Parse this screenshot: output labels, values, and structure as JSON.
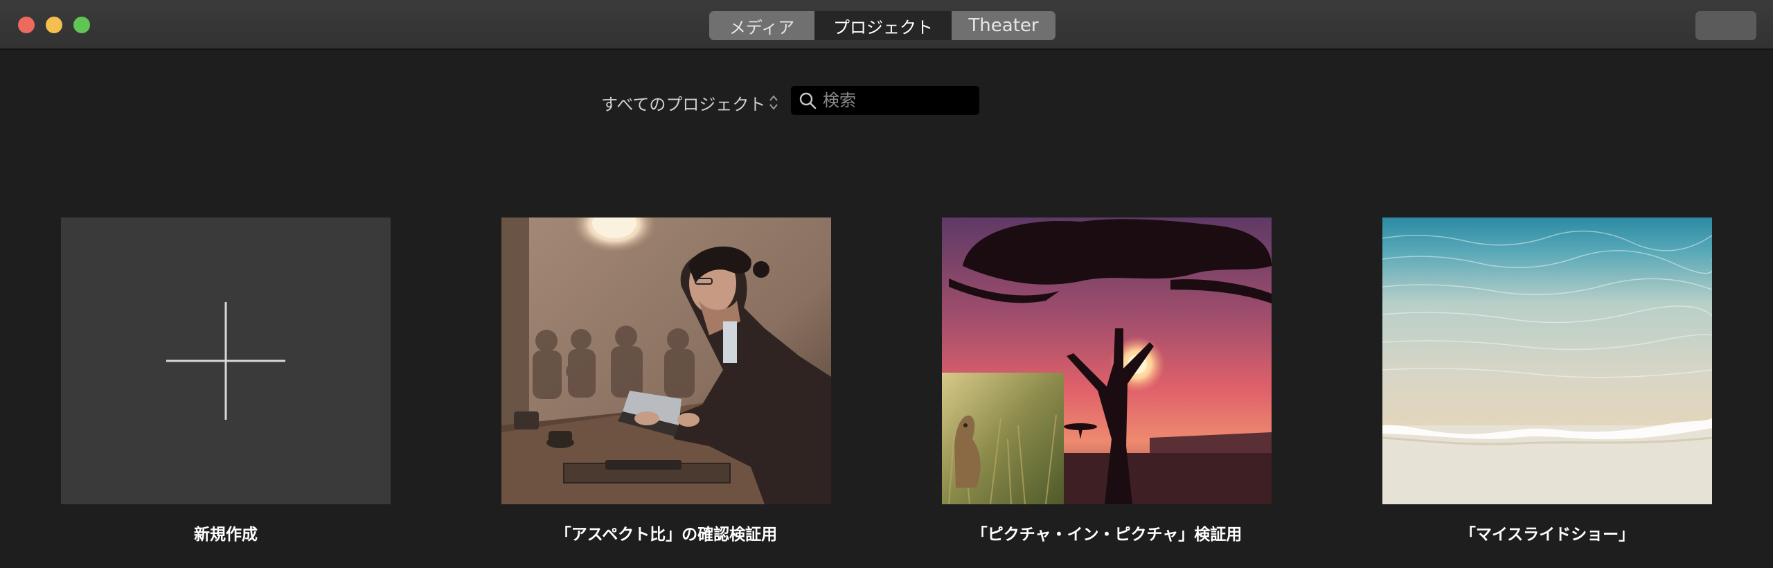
{
  "window": {
    "controls": [
      "close",
      "minimize",
      "maximize"
    ]
  },
  "tabs": [
    {
      "label": "メディア",
      "selected": false
    },
    {
      "label": "プロジェクト",
      "selected": true
    },
    {
      "label": "Theater",
      "selected": false
    }
  ],
  "filter": {
    "label": "すべてのプロジェクト",
    "icon": "updown-chevron-icon"
  },
  "search": {
    "placeholder": "検索",
    "value": "",
    "icon": "search-icon"
  },
  "projects": [
    {
      "title": "新規作成",
      "type": "new",
      "icon": "plus-icon"
    },
    {
      "title": "「アスペクト比」の確認検証用",
      "type": "project",
      "thumbnail": "cafe-man-laptop"
    },
    {
      "title": "「ピクチャ・イン・ピクチャ」検証用",
      "type": "project",
      "thumbnail": "savanna-sunset-tree"
    },
    {
      "title": "「マイスライドショー」",
      "type": "project",
      "thumbnail": "beach-shore"
    }
  ],
  "colors": {
    "background": "#1e1e1e",
    "titlebar": "#363636",
    "segment_inactive": "#707070",
    "segment_active": "#262626",
    "close": "#ed6a5e",
    "minimize": "#f4bf4f",
    "maximize": "#61c554"
  }
}
